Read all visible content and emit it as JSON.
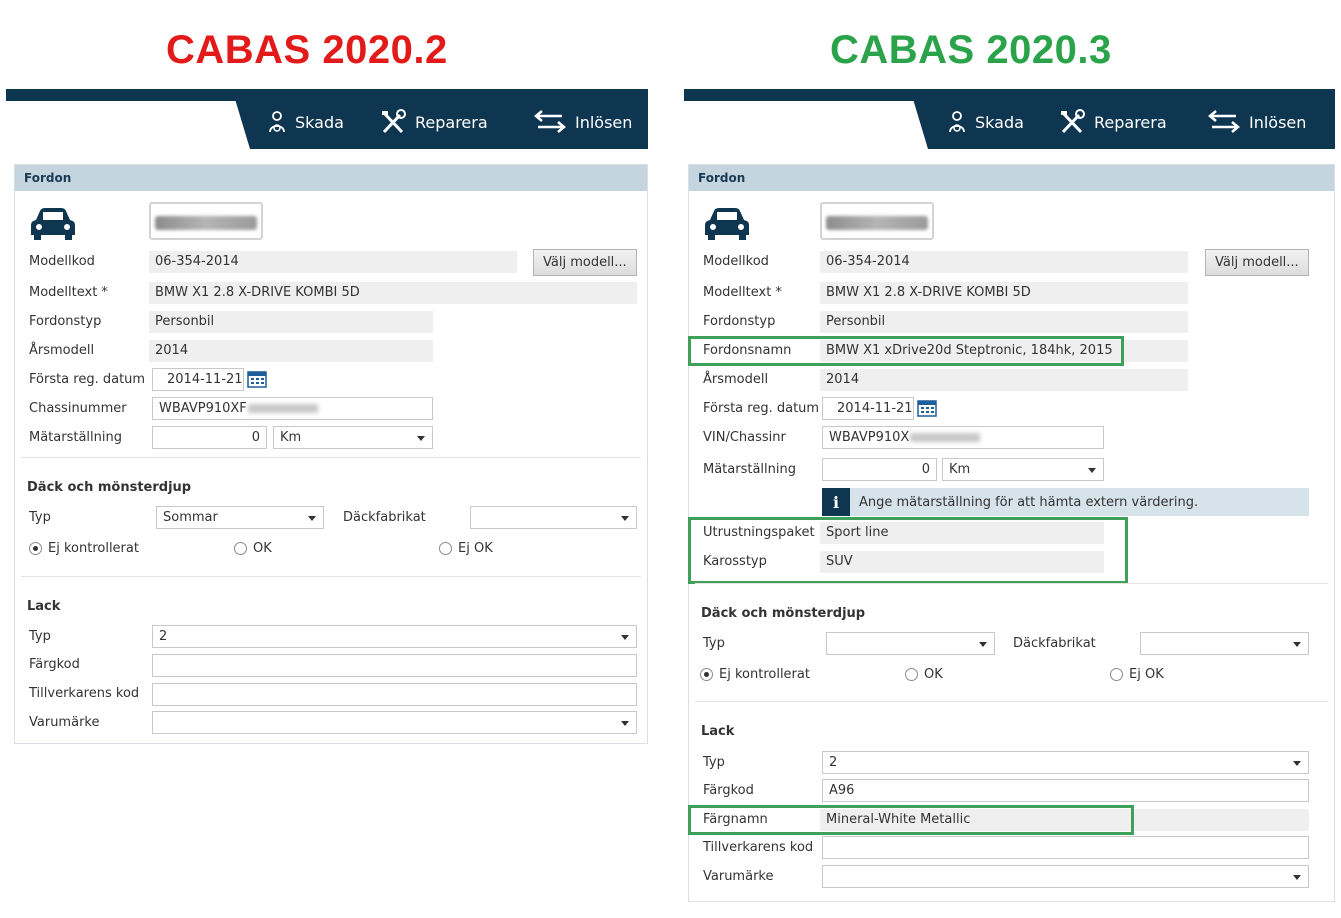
{
  "titles": {
    "left": "CABAS 2020.2",
    "right": "CABAS 2020.3"
  },
  "nav": {
    "skada": "Skada",
    "reparera": "Reparera",
    "inlosen": "Inlösen"
  },
  "card_title": "Fordon",
  "left": {
    "modellkod_label": "Modellkod",
    "modellkod": "06-354-2014",
    "valj_modell": "Välj modell...",
    "modelltext_label": "Modelltext *",
    "modelltext": "BMW X1 2.8 X-DRIVE KOMBI 5D",
    "fordonstyp_label": "Fordonstyp",
    "fordonstyp": "Personbil",
    "arsmodell_label": "Årsmodell",
    "arsmodell": "2014",
    "forsta_reg_label": "Första reg. datum",
    "forsta_reg": "2014-11-21",
    "chassi_label": "Chassinummer",
    "chassi": "WBAVP910XF",
    "matar_label": "Mätarställning",
    "matar": "0",
    "matar_unit": "Km",
    "dack_title": "Däck och mönsterdjup",
    "typ_label": "Typ",
    "typ": "Sommar",
    "dackfabrikat_label": "Däckfabrikat",
    "dackfabrikat": "",
    "radio_ej_kontrollerat": "Ej kontrollerat",
    "radio_ok": "OK",
    "radio_ej_ok": "Ej OK",
    "lack_title": "Lack",
    "lack_typ_label": "Typ",
    "lack_typ": "2",
    "fargkod_label": "Färgkod",
    "fargkod": "",
    "tillverkare_label": "Tillverkarens kod",
    "tillverkare": "",
    "varumarke_label": "Varumärke",
    "varumarke": ""
  },
  "right": {
    "modellkod_label": "Modellkod",
    "modellkod": "06-354-2014",
    "valj_modell": "Välj modell...",
    "modelltext_label": "Modelltext *",
    "modelltext": "BMW X1 2.8 X-DRIVE KOMBI 5D",
    "fordonstyp_label": "Fordonstyp",
    "fordonstyp": "Personbil",
    "fordonsnamn_label": "Fordonsnamn",
    "fordonsnamn": "BMW X1 xDrive20d  Steptronic, 184hk, 2015",
    "arsmodell_label": "Årsmodell",
    "arsmodell": "2014",
    "forsta_reg_label": "Första reg. datum",
    "forsta_reg": "2014-11-21",
    "vin_label": "VIN/Chassinr",
    "vin": "WBAVP910X",
    "matar_label": "Mätarställning",
    "matar": "0",
    "matar_unit": "Km",
    "info_text": "Ange mätarställning för att hämta extern värdering.",
    "utrustning_label": "Utrustningspaket",
    "utrustning": "Sport line",
    "karosstyp_label": "Karosstyp",
    "karosstyp": "SUV",
    "dack_title": "Däck och mönsterdjup",
    "typ_label": "Typ",
    "typ": "",
    "dackfabrikat_label": "Däckfabrikat",
    "dackfabrikat": "",
    "radio_ej_kontrollerat": "Ej kontrollerat",
    "radio_ok": "OK",
    "radio_ej_ok": "Ej OK",
    "lack_title": "Lack",
    "lack_typ_label": "Typ",
    "lack_typ": "2",
    "fargkod_label": "Färgkod",
    "fargkod": "A96",
    "fargnamn_label": "Färgnamn",
    "fargnamn": "Mineral-White Metallic",
    "tillverkare_label": "Tillverkarens kod",
    "tillverkare": "",
    "varumarke_label": "Varumärke",
    "varumarke": ""
  },
  "colors": {
    "navy": "#0f3650",
    "highlight": "#3fa05a",
    "title_old": "#e21a1a",
    "title_new": "#2aa34a"
  },
  "icons": [
    "skada-driver-icon",
    "reparera-tools-icon",
    "inlosen-arrows-icon",
    "car-icon",
    "calendar-icon",
    "info-icon",
    "chevron-down-icon"
  ]
}
